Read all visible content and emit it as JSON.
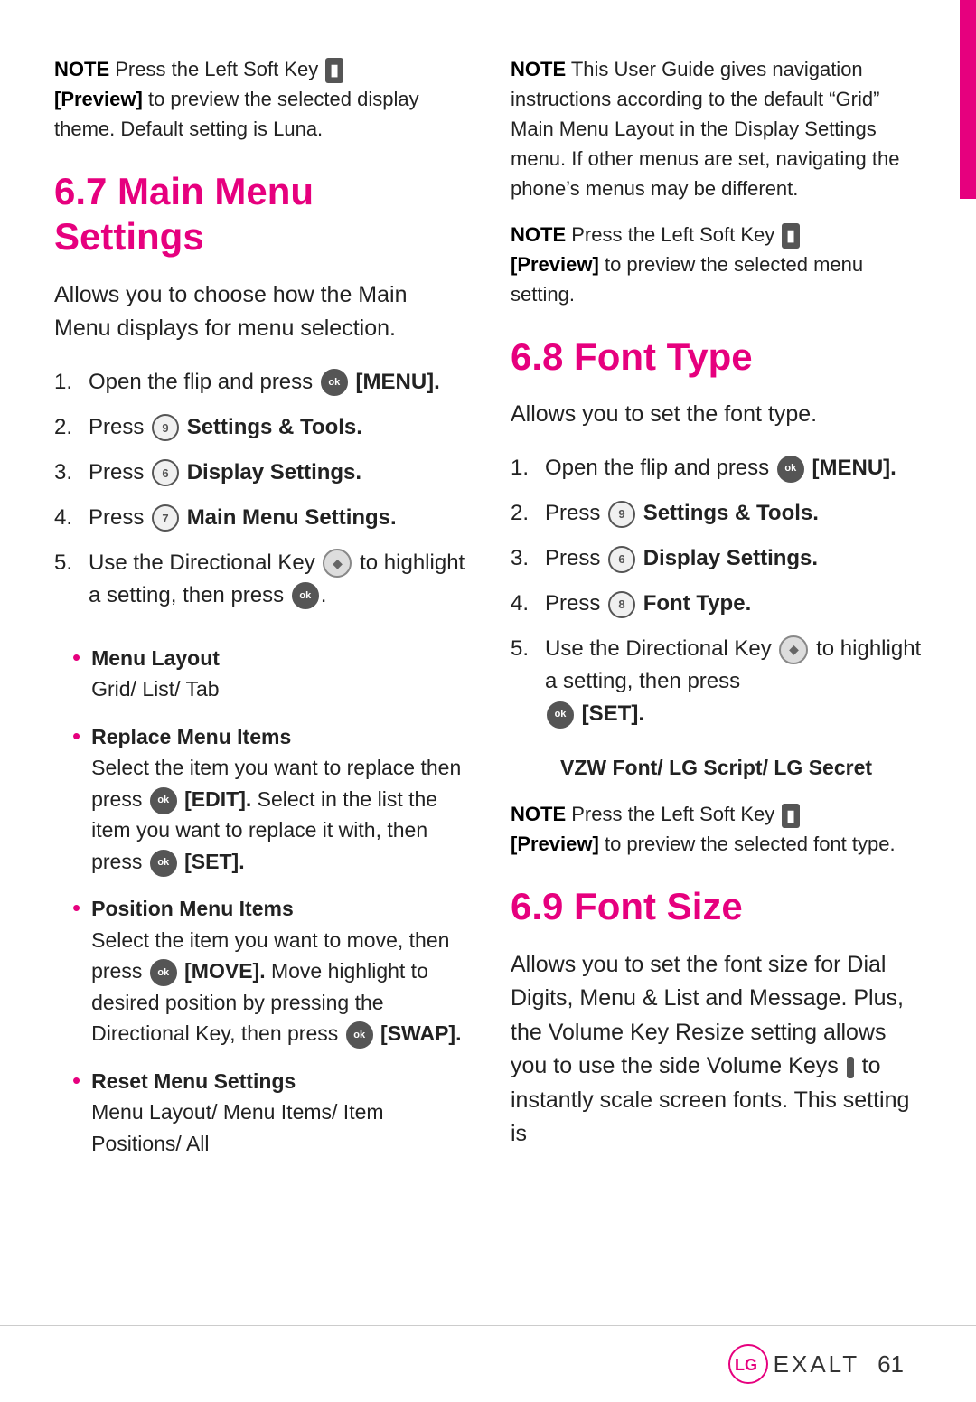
{
  "page": {
    "pinkBar": true,
    "footer": {
      "logo": "LG",
      "brand": "EXALT",
      "pageNumber": "61"
    }
  },
  "left": {
    "noteTop": {
      "label": "NOTE",
      "text1": "Press the Left Soft Key",
      "bracketText": "[Preview]",
      "text2": "to preview the selected display theme. Default setting is Luna."
    },
    "section67": {
      "heading": "6.7 Main Menu Settings",
      "intro": "Allows you to choose how the Main Menu displays for menu selection.",
      "steps": [
        {
          "num": "1.",
          "text": "Open the flip and press",
          "bold": "[MENU]."
        },
        {
          "num": "2.",
          "text": "Press",
          "icon": "9",
          "bold": "Settings & Tools."
        },
        {
          "num": "3.",
          "text": "Press",
          "icon": "6",
          "bold": "Display Settings."
        },
        {
          "num": "4.",
          "text": "Press",
          "icon": "7",
          "bold": "Main Menu Settings."
        },
        {
          "num": "5.",
          "text": "Use the Directional Key",
          "text2": "to highlight a setting, then press",
          "text3": "."
        }
      ],
      "bullets": [
        {
          "title": "Menu Layout",
          "body": "Grid/ List/ Tab"
        },
        {
          "title": "Replace Menu Items",
          "body": "Select the item you want to replace then press Ⓞ [EDIT]. Select in the list the item you want to replace it with, then press Ⓞ [SET]."
        },
        {
          "title": "Position Menu Items",
          "body": "Select the item you want to move, then press Ⓞ [MOVE]. Move highlight to desired position by pressing the Directional Key, then press Ⓞ [SWAP]."
        },
        {
          "title": "Reset Menu Settings",
          "body": "Menu Layout/ Menu Items/ Item Positions/ All"
        }
      ]
    }
  },
  "right": {
    "noteTop": {
      "label": "NOTE",
      "text1": "This User Guide gives navigation instructions according to the default “Grid” Main Menu Layout in the Display Settings menu. If other menus are set, navigating the phone’s menus may be different."
    },
    "noteMiddle": {
      "label": "NOTE",
      "text1": "Press the Left Soft Key",
      "bracketText": "[Preview]",
      "text2": "to preview the selected menu setting."
    },
    "section68": {
      "heading": "6.8 Font Type",
      "intro": "Allows you to set the font type.",
      "steps": [
        {
          "num": "1.",
          "text": "Open the flip and press",
          "bold": "[MENU]."
        },
        {
          "num": "2.",
          "text": "Press",
          "icon": "9",
          "bold": "Settings & Tools."
        },
        {
          "num": "3.",
          "text": "Press",
          "icon": "6",
          "bold": "Display Settings."
        },
        {
          "num": "4.",
          "text": "Press",
          "icon": "8",
          "bold": "Font Type."
        },
        {
          "num": "5.",
          "text": "Use the Directional Key",
          "text2": "to highlight a setting, then press",
          "bold2": "Ⓞ [SET]."
        }
      ],
      "fontOptions": "VZW Font/ LG Script/ LG Secret",
      "noteBottom": {
        "label": "NOTE",
        "text1": "Press the Left Soft Key",
        "bracketText": "[Preview]",
        "text2": "to preview the selected font type."
      }
    },
    "section69": {
      "heading": "6.9 Font Size",
      "intro": "Allows you to set the font size for Dial Digits, Menu & List and Message. Plus, the Volume Key Resize setting allows you to use the side Volume Keys",
      "introEnd": "to instantly scale screen fonts. This setting is"
    }
  }
}
